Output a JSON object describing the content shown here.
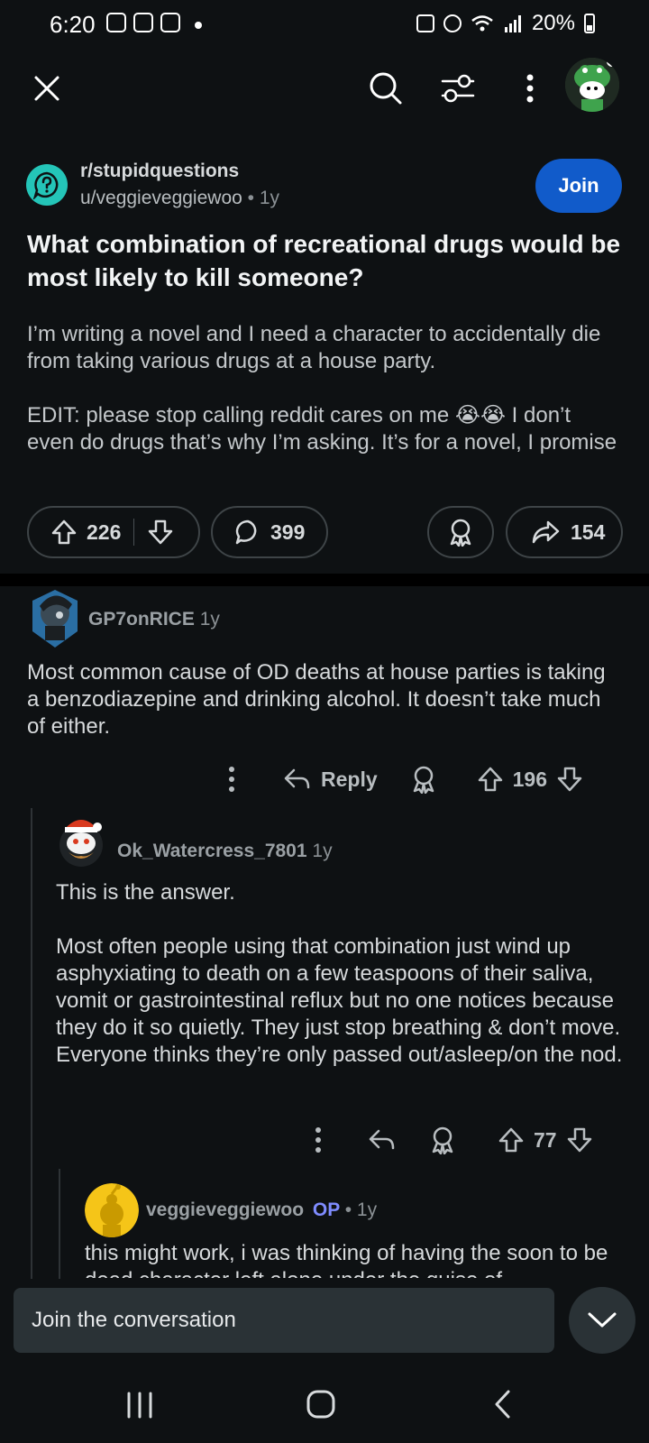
{
  "status_bar": {
    "time": "6:20",
    "battery": "20%"
  },
  "toolbar": {
    "close_icon": "close-icon",
    "search_icon": "search-icon",
    "filter_icon": "sort-filter-icon",
    "more_icon": "more-vertical-icon"
  },
  "post": {
    "subreddit": "r/stupidquestions",
    "author": "u/veggieveggiewoo",
    "age": "1y",
    "join_label": "Join",
    "title": "What combination of recreational drugs would be most likely to kill someone?",
    "body": [
      "I’m writing a novel and I need a character to accidentally die from taking various drugs at a house party.",
      "EDIT: please stop calling reddit cares on me 😭😭 I don’t even do drugs that’s why I’m asking. It’s for a novel, I promise"
    ],
    "upvotes": "226",
    "comments": "399",
    "shares": "154"
  },
  "comments": [
    {
      "author": "GP7onRICE",
      "age": "1y",
      "body": [
        "Most common cause of OD deaths at house parties is taking a benzodiazepine and drinking alcohol. It doesn’t take much of either."
      ],
      "reply_label": "Reply",
      "votes": "196"
    },
    {
      "author": "Ok_Watercress_7801",
      "age": "1y",
      "body": [
        "This is the answer.",
        "Most often people using that combination just wind up asphyxiating to death on a few teaspoons of their saliva, vomit or gastrointestinal reflux but no one notices because they do it so quietly. They just stop breathing & don’t move. Everyone thinks they’re only passed out/asleep/on the nod."
      ],
      "votes": "77"
    },
    {
      "author": "veggieveggiewoo",
      "op_badge": "OP",
      "age": "1y",
      "body": [
        "this might work, i was thinking of having the soon to be dead character left alone under the guise of"
      ]
    }
  ],
  "composer": {
    "placeholder": "Join the conversation"
  }
}
